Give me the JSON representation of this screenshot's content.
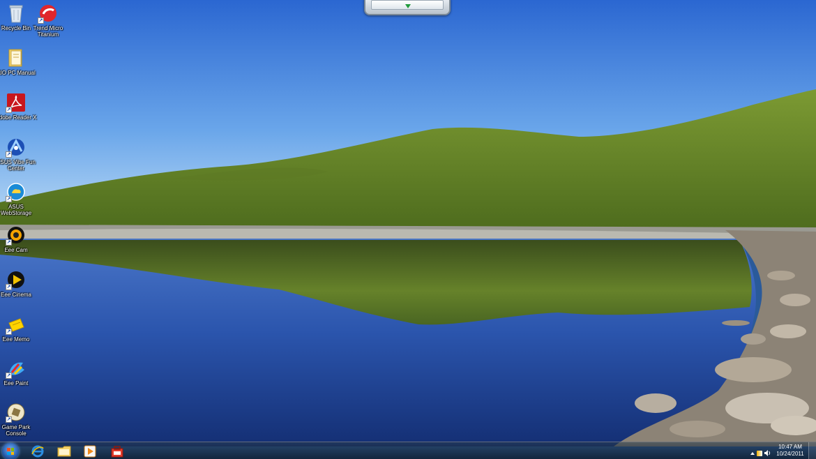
{
  "desktop_icons": [
    {
      "label": "Recycle Bin",
      "icon": "recycle-bin-icon"
    },
    {
      "label": "Trend Micro Titanium",
      "icon": "trend-micro-icon"
    },
    {
      "label": "AIO PC Manual",
      "icon": "folder-icon"
    },
    {
      "label": "Adobe Reader X",
      "icon": "adobe-reader-icon"
    },
    {
      "label": "ASUS Vibe Fun Center",
      "icon": "asus-vibe-icon"
    },
    {
      "label": "ASUS WebStorage",
      "icon": "asus-webstorage-icon"
    },
    {
      "label": "Eee Cam",
      "icon": "eee-cam-icon"
    },
    {
      "label": "Eee Cinema",
      "icon": "eee-cinema-icon"
    },
    {
      "label": "Eee Memo",
      "icon": "eee-memo-icon"
    },
    {
      "label": "Eee Paint",
      "icon": "eee-paint-icon"
    },
    {
      "label": "Game Park Console",
      "icon": "game-park-icon"
    }
  ],
  "taskbar": {
    "pinned": [
      {
        "name": "internet-explorer",
        "icon": "internet-explorer-icon"
      },
      {
        "name": "windows-explorer",
        "icon": "folder-icon"
      },
      {
        "name": "media-player",
        "icon": "media-player-icon"
      },
      {
        "name": "toolbox",
        "icon": "toolbox-icon"
      }
    ],
    "tray": {
      "time": "10:47 AM",
      "date": "10/24/2011"
    }
  },
  "colors": {
    "sky_top": "#2f6fd6",
    "sky_bottom": "#b9d9f3",
    "grass": "#6b8a2c",
    "water": "#1c3f8f"
  }
}
